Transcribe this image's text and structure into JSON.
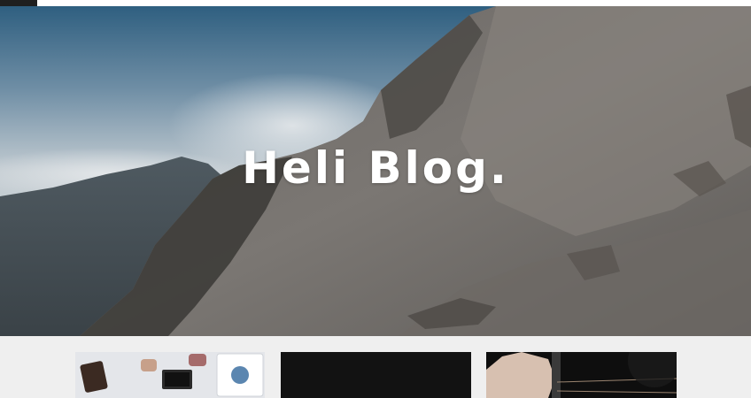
{
  "site": {
    "title": "Heli Blog."
  },
  "colors": {
    "page_background": "#efefef",
    "title_text": "#ffffff",
    "top_tab": "#1f1f1f"
  },
  "posts": [
    {
      "thumbnail_subject": "desk-with-tablet-and-notebook"
    },
    {
      "thumbnail_subject": "dark-image"
    },
    {
      "thumbnail_subject": "hand-playing-guitar"
    }
  ]
}
